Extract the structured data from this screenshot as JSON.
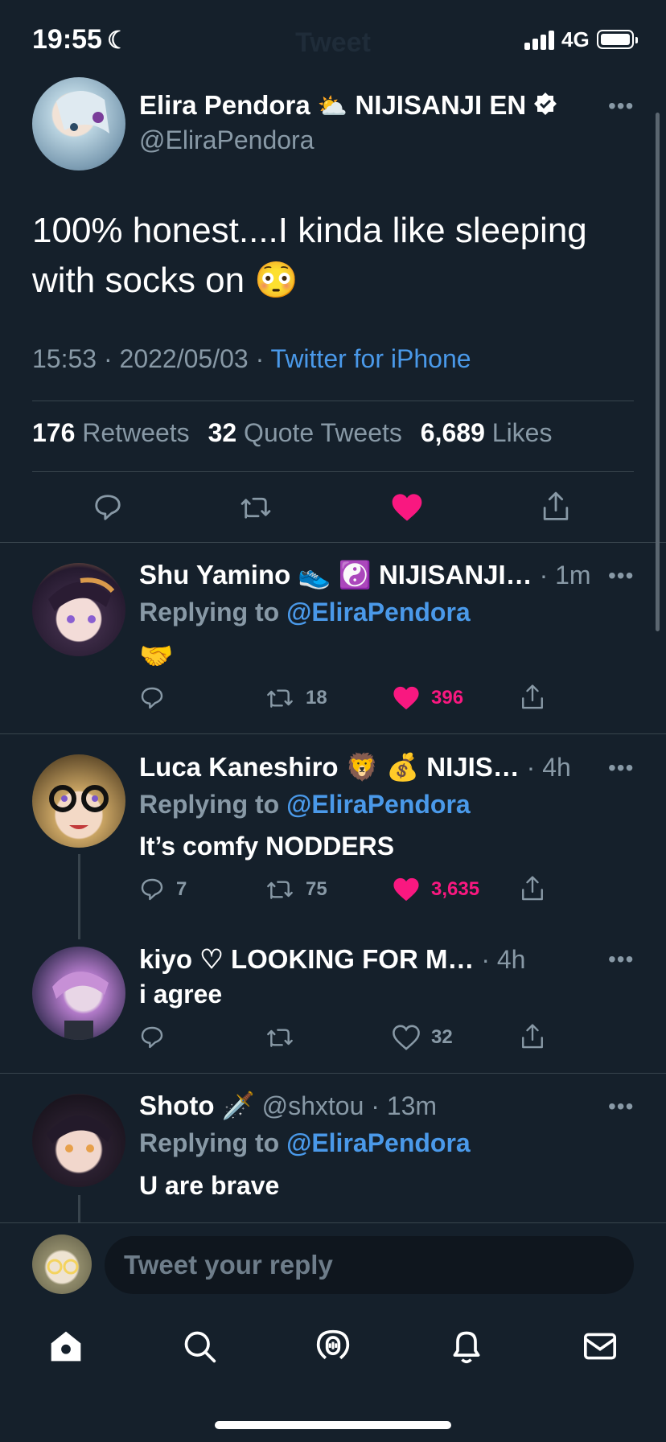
{
  "status_bar": {
    "time": "19:55",
    "network": "4G",
    "title": "Tweet"
  },
  "tweet": {
    "author_name": "Elira Pendora",
    "author_emoji": "⛅",
    "author_suffix": "NIJISANJI EN",
    "handle": "@EliraPendora",
    "text": "100% honest....I kinda like sleeping with socks on 😳",
    "time": "15:53",
    "date": "2022/05/03",
    "source": "Twitter for iPhone",
    "retweets_count": "176",
    "retweets_label": "Retweets",
    "quotes_count": "32",
    "quotes_label": "Quote Tweets",
    "likes_count": "6,689",
    "likes_label": "Likes"
  },
  "replies": [
    {
      "name": "Shu Yamino 👟 ☯️ NIJISANJI…",
      "time": "· 1m",
      "replying_label": "Replying to",
      "replying_handle": "@EliraPendora",
      "text": "🤝",
      "comments": "",
      "retweets": "18",
      "likes": "396",
      "liked": true
    },
    {
      "name": "Luca Kaneshiro 🦁 💰 NIJIS…",
      "time": "· 4h",
      "replying_label": "Replying to",
      "replying_handle": "@EliraPendora",
      "text": "It’s comfy NODDERS",
      "comments": "7",
      "retweets": "75",
      "likes": "3,635",
      "liked": true
    },
    {
      "name": "kiyo ♡ LOOKING FOR M…",
      "time": "· 4h",
      "text": "i agree",
      "comments": "",
      "retweets": "",
      "likes": "32",
      "liked": false
    },
    {
      "name": "Shoto 🗡️",
      "handle": "@shxtou",
      "time": "· 13m",
      "replying_label": "Replying to",
      "replying_handle": "@EliraPendora",
      "text": "U are brave"
    }
  ],
  "compose": {
    "placeholder": "Tweet your reply"
  },
  "colors": {
    "background": "#15202b",
    "accent": "#4a99e9",
    "like": "#f91880",
    "muted": "#8899a6"
  },
  "icons": [
    "home-icon",
    "search-icon",
    "spaces-icon",
    "notifications-icon",
    "messages-icon"
  ]
}
